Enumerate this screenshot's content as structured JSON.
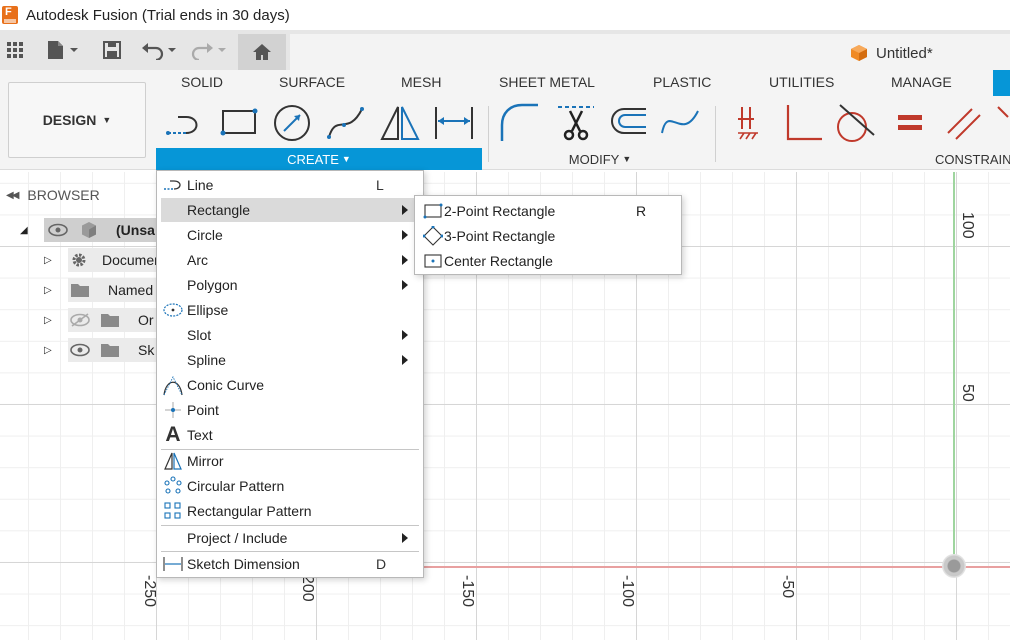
{
  "window": {
    "title": "Autodesk Fusion (Trial ends in 30 days)",
    "logo_letter": "F"
  },
  "document": {
    "name": "Untitled*"
  },
  "workspace": {
    "label": "DESIGN"
  },
  "tabs": [
    "SOLID",
    "SURFACE",
    "MESH",
    "SHEET METAL",
    "PLASTIC",
    "UTILITIES",
    "MANAGE"
  ],
  "groups": {
    "create": "CREATE",
    "modify": "MODIFY",
    "constrain": "CONSTRAIN"
  },
  "browser": {
    "title": "BROWSER",
    "rows": [
      "(Unsa",
      "Documen",
      "Named",
      "Or",
      "Sk"
    ]
  },
  "axis_labels": {
    "x": [
      "-250",
      "200",
      "-150",
      "-100",
      "-50"
    ],
    "y": [
      "100",
      "50"
    ]
  },
  "create_menu": {
    "items": [
      {
        "label": "Line",
        "shortcut": "L"
      },
      {
        "label": "Rectangle"
      },
      {
        "label": "Circle"
      },
      {
        "label": "Arc"
      },
      {
        "label": "Polygon"
      },
      {
        "label": "Ellipse"
      },
      {
        "label": "Slot"
      },
      {
        "label": "Spline"
      },
      {
        "label": "Conic Curve"
      },
      {
        "label": "Point"
      },
      {
        "label": "Text"
      },
      {
        "label": "Mirror"
      },
      {
        "label": "Circular Pattern"
      },
      {
        "label": "Rectangular Pattern"
      },
      {
        "label": "Project / Include"
      },
      {
        "label": "Sketch Dimension",
        "shortcut": "D"
      }
    ]
  },
  "rectangle_submenu": {
    "items": [
      {
        "label": "2-Point Rectangle",
        "shortcut": "R"
      },
      {
        "label": "3-Point Rectangle"
      },
      {
        "label": "Center Rectangle"
      }
    ]
  },
  "colors": {
    "accent": "#0696d7",
    "x_axis": "#e8a0a0",
    "y_axis": "#9fd59f",
    "constraint_red": "#c0392b"
  }
}
